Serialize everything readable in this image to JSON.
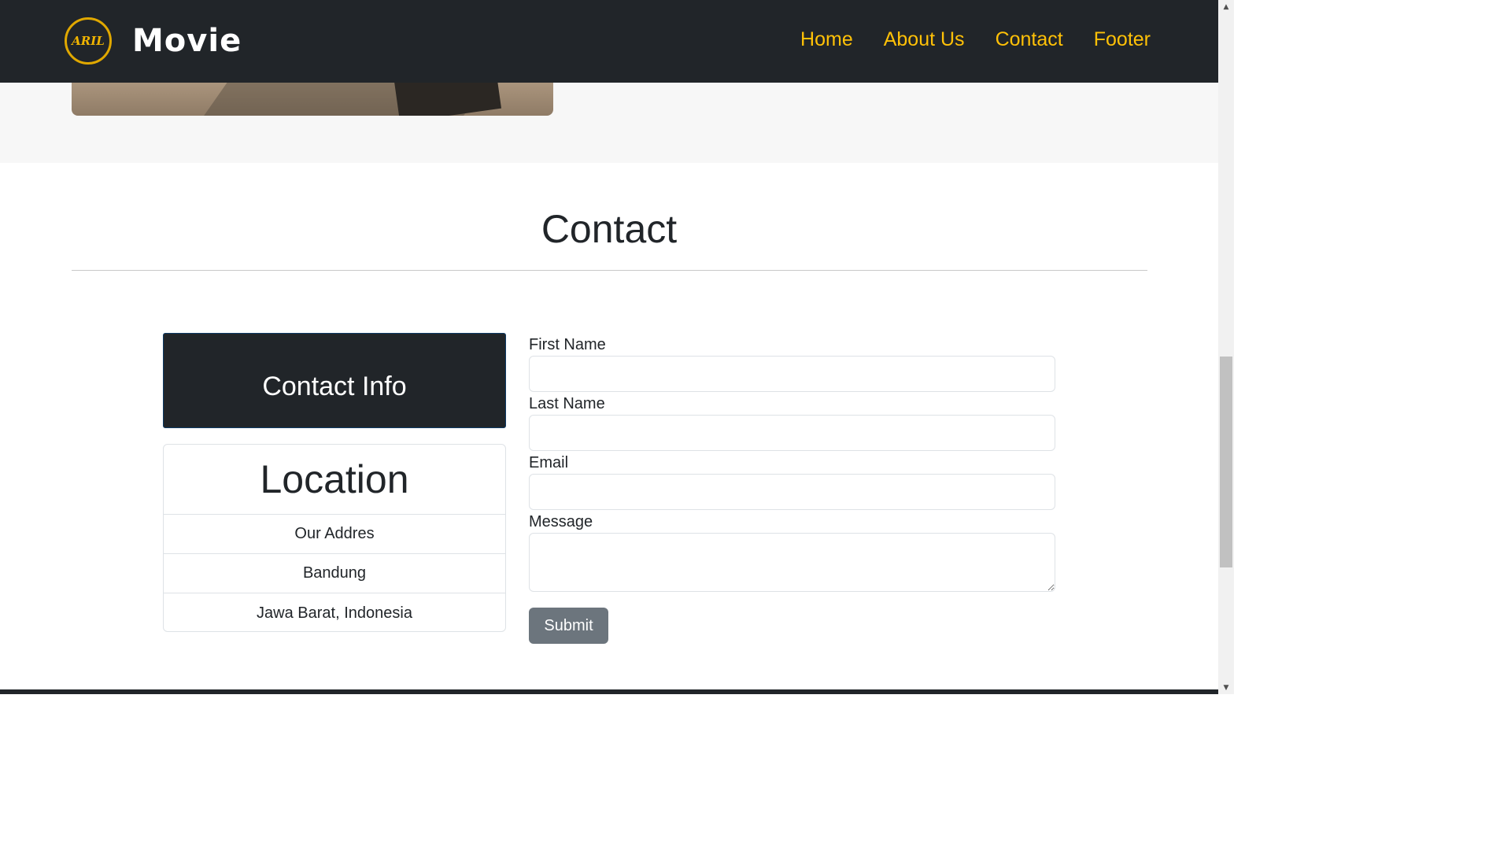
{
  "navbar": {
    "logo_text": "ARIL",
    "brand": "Movie",
    "links": [
      {
        "label": "Home"
      },
      {
        "label": "About Us"
      },
      {
        "label": "Contact"
      },
      {
        "label": "Footer"
      }
    ]
  },
  "contact": {
    "heading": "Contact",
    "info_title": "Contact Info",
    "location": {
      "title": "Location",
      "rows": [
        "Our Addres",
        "Bandung",
        "Jawa Barat, Indonesia"
      ]
    },
    "form": {
      "first_name_label": "First Name",
      "last_name_label": "Last Name",
      "email_label": "Email",
      "message_label": "Message",
      "first_name_value": "",
      "last_name_value": "",
      "email_value": "",
      "message_value": "",
      "submit_label": "Submit"
    }
  },
  "colors": {
    "navbar_bg": "#212529",
    "accent": "#ffc107",
    "submit_bg": "#6c757d"
  },
  "icons": {
    "scroll_up": "▲",
    "scroll_down": "▼"
  }
}
